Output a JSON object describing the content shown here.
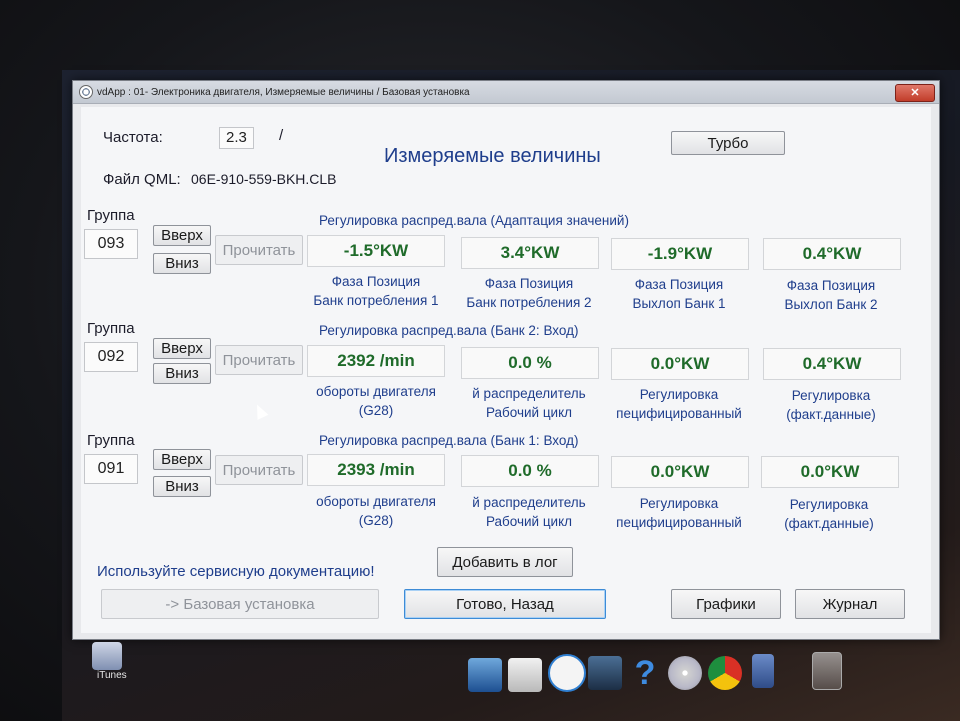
{
  "window": {
    "title": "vdApp : 01- Электроника двигателя,  Измеряемые величины / Базовая установка",
    "close_label": "✕"
  },
  "header": {
    "freq_label": "Частота:",
    "freq_value": "2.3",
    "freq_sep": "/",
    "file_label": "Файл QML:",
    "file_value": "06E-910-559-BKH.CLB",
    "page_title": "Измеряемые величины",
    "turbo_button": "Турбо"
  },
  "groups": [
    {
      "label": "Группа",
      "number": "093",
      "up": "Вверх",
      "down": "Вниз",
      "read": "Прочитать",
      "title": "Регулировка распред.вала (Адаптация значений)",
      "cells": [
        {
          "value": "-1.5°KW",
          "caption1": "Фаза Позиция",
          "caption2": "Банк потребления 1"
        },
        {
          "value": "3.4°KW",
          "caption1": "Фаза Позиция",
          "caption2": "Банк потребления 2"
        },
        {
          "value": "-1.9°KW",
          "caption1": "Фаза Позиция",
          "caption2": "Выхлоп Банк 1"
        },
        {
          "value": "0.4°KW",
          "caption1": "Фаза Позиция",
          "caption2": "Выхлоп Банк 2"
        }
      ]
    },
    {
      "label": "Группа",
      "number": "092",
      "up": "Вверх",
      "down": "Вниз",
      "read": "Прочитать",
      "title": "Регулировка распред.вала (Банк 2: Вход)",
      "cells": [
        {
          "value": "2392 /min",
          "caption1": "обороты двигателя",
          "caption2": "(G28)"
        },
        {
          "value": "0.0 %",
          "caption1": "й распределитель",
          "caption2": "Рабочий цикл"
        },
        {
          "value": "0.0°KW",
          "caption1": "Регулировка",
          "caption2": "пецифицированный"
        },
        {
          "value": "0.4°KW",
          "caption1": "Регулировка",
          "caption2": "(факт.данные)"
        }
      ]
    },
    {
      "label": "Группа",
      "number": "091",
      "up": "Вверх",
      "down": "Вниз",
      "read": "Прочитать",
      "title": "Регулировка распред.вала (Банк 1: Вход)",
      "cells": [
        {
          "value": "2393 /min",
          "caption1": "обороты двигателя",
          "caption2": "(G28)"
        },
        {
          "value": "0.0 %",
          "caption1": "й распределитель",
          "caption2": "Рабочий цикл"
        },
        {
          "value": "0.0°KW",
          "caption1": "Регулировка",
          "caption2": "пецифицированный"
        },
        {
          "value": "0.0°KW",
          "caption1": "Регулировка",
          "caption2": "(факт.данные)"
        }
      ]
    }
  ],
  "footer": {
    "note": "Используйте сервисную документацию!",
    "add_log": "Добавить в лог",
    "basic_settings": "-> Базовая установка",
    "done_back": "Готово, Назад",
    "graphs": "Графики",
    "journal": "Журнал"
  },
  "desktop": {
    "itunes_label": "iTunes"
  },
  "colors": {
    "heading_blue": "#1f3e8c",
    "value_green": "#1f6b2a",
    "close_red": "#c13d2a"
  }
}
